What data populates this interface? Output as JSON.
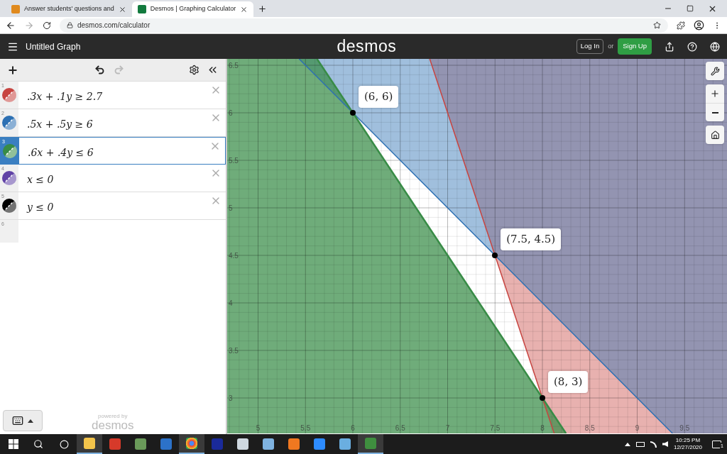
{
  "browser": {
    "tabs": [
      {
        "title": "Answer students' questions and",
        "selected": false
      },
      {
        "title": "Desmos | Graphing Calculator",
        "selected": true
      }
    ],
    "address": "desmos.com/calculator"
  },
  "header": {
    "title": "Untitled Graph",
    "logo": "desmos",
    "login": "Log In",
    "or": "or",
    "signup": "Sign Up"
  },
  "expressions": [
    {
      "number": "1",
      "text": ".3x + .1y ≥ 2.7",
      "color": "#c74440",
      "selected": false
    },
    {
      "number": "2",
      "text": ".5x + .5y ≥ 6",
      "color": "#2d70b3",
      "selected": false
    },
    {
      "number": "3",
      "text": ".6x + .4y ≤ 6",
      "color": "#388c46",
      "selected": true
    },
    {
      "number": "4",
      "text": "x ≤ 0",
      "color": "#6042a6",
      "selected": false
    },
    {
      "number": "5",
      "text": "y ≤ 0",
      "color": "#000000",
      "selected": false
    }
  ],
  "empty_row_number": "6",
  "footer": {
    "powered": "powered by",
    "logo": "desmos"
  },
  "graph": {
    "x_ticks": [
      "5",
      "5.5",
      "6",
      "6.5",
      "7",
      "7.5",
      "8",
      "8.5",
      "9",
      "9.5"
    ],
    "y_ticks": [
      "6.5",
      "6",
      "5.5",
      "5",
      "4.5",
      "4",
      "3.5",
      "3"
    ],
    "points": [
      {
        "label": "(6, 6)"
      },
      {
        "label": "(7.5, 4.5)"
      },
      {
        "label": "(8, 3)"
      }
    ]
  },
  "taskbar": {
    "time": "10:25 PM",
    "date": "12/27/2020",
    "notifications": "1"
  }
}
